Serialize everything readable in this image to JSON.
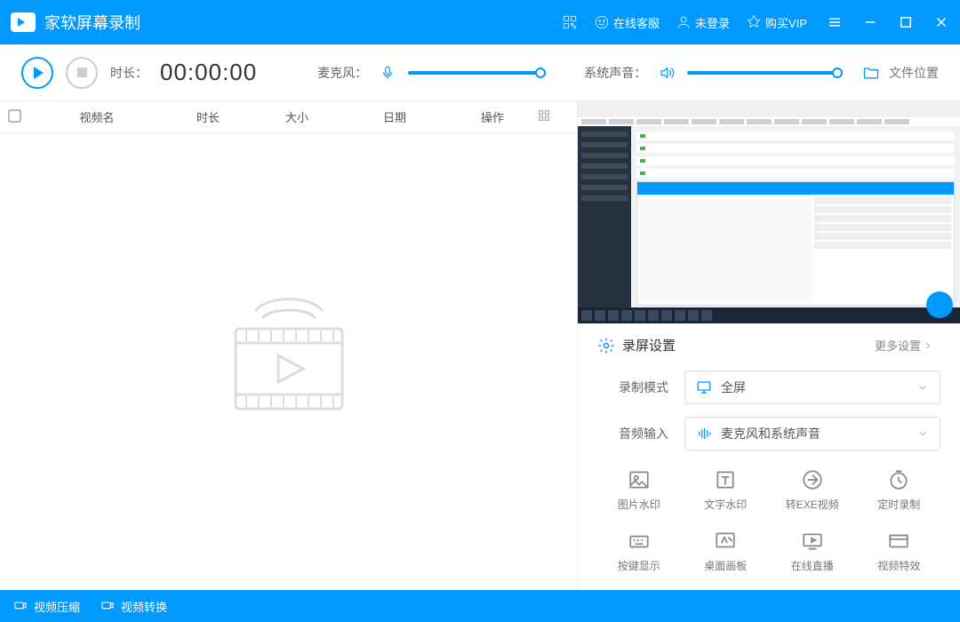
{
  "titlebar": {
    "app_title": "家软屏幕录制",
    "customer_service": "在线客服",
    "login_status": "未登录",
    "buy_vip": "购买VIP"
  },
  "toolbar": {
    "duration_label": "时长：",
    "duration_value": "00:00:00",
    "mic_label": "麦克风：",
    "speaker_label": "系统声音：",
    "folder_label": "文件位置"
  },
  "table": {
    "headers": {
      "name": "视频名",
      "duration": "时长",
      "size": "大小",
      "date": "日期",
      "operation": "操作"
    }
  },
  "settings": {
    "title": "录屏设置",
    "more": "更多设置",
    "record_mode_label": "录制模式",
    "record_mode_value": "全屏",
    "audio_input_label": "音频输入",
    "audio_input_value": "麦克风和系统声音",
    "tools": {
      "image_watermark": "图片水印",
      "text_watermark": "文字水印",
      "to_exe": "转EXE视频",
      "scheduled": "定时录制",
      "key_display": "按键显示",
      "drawing_board": "桌面画板",
      "live_stream": "在线直播",
      "video_effect": "视频特效"
    }
  },
  "footer": {
    "compress": "视频压缩",
    "convert": "视频转换"
  }
}
